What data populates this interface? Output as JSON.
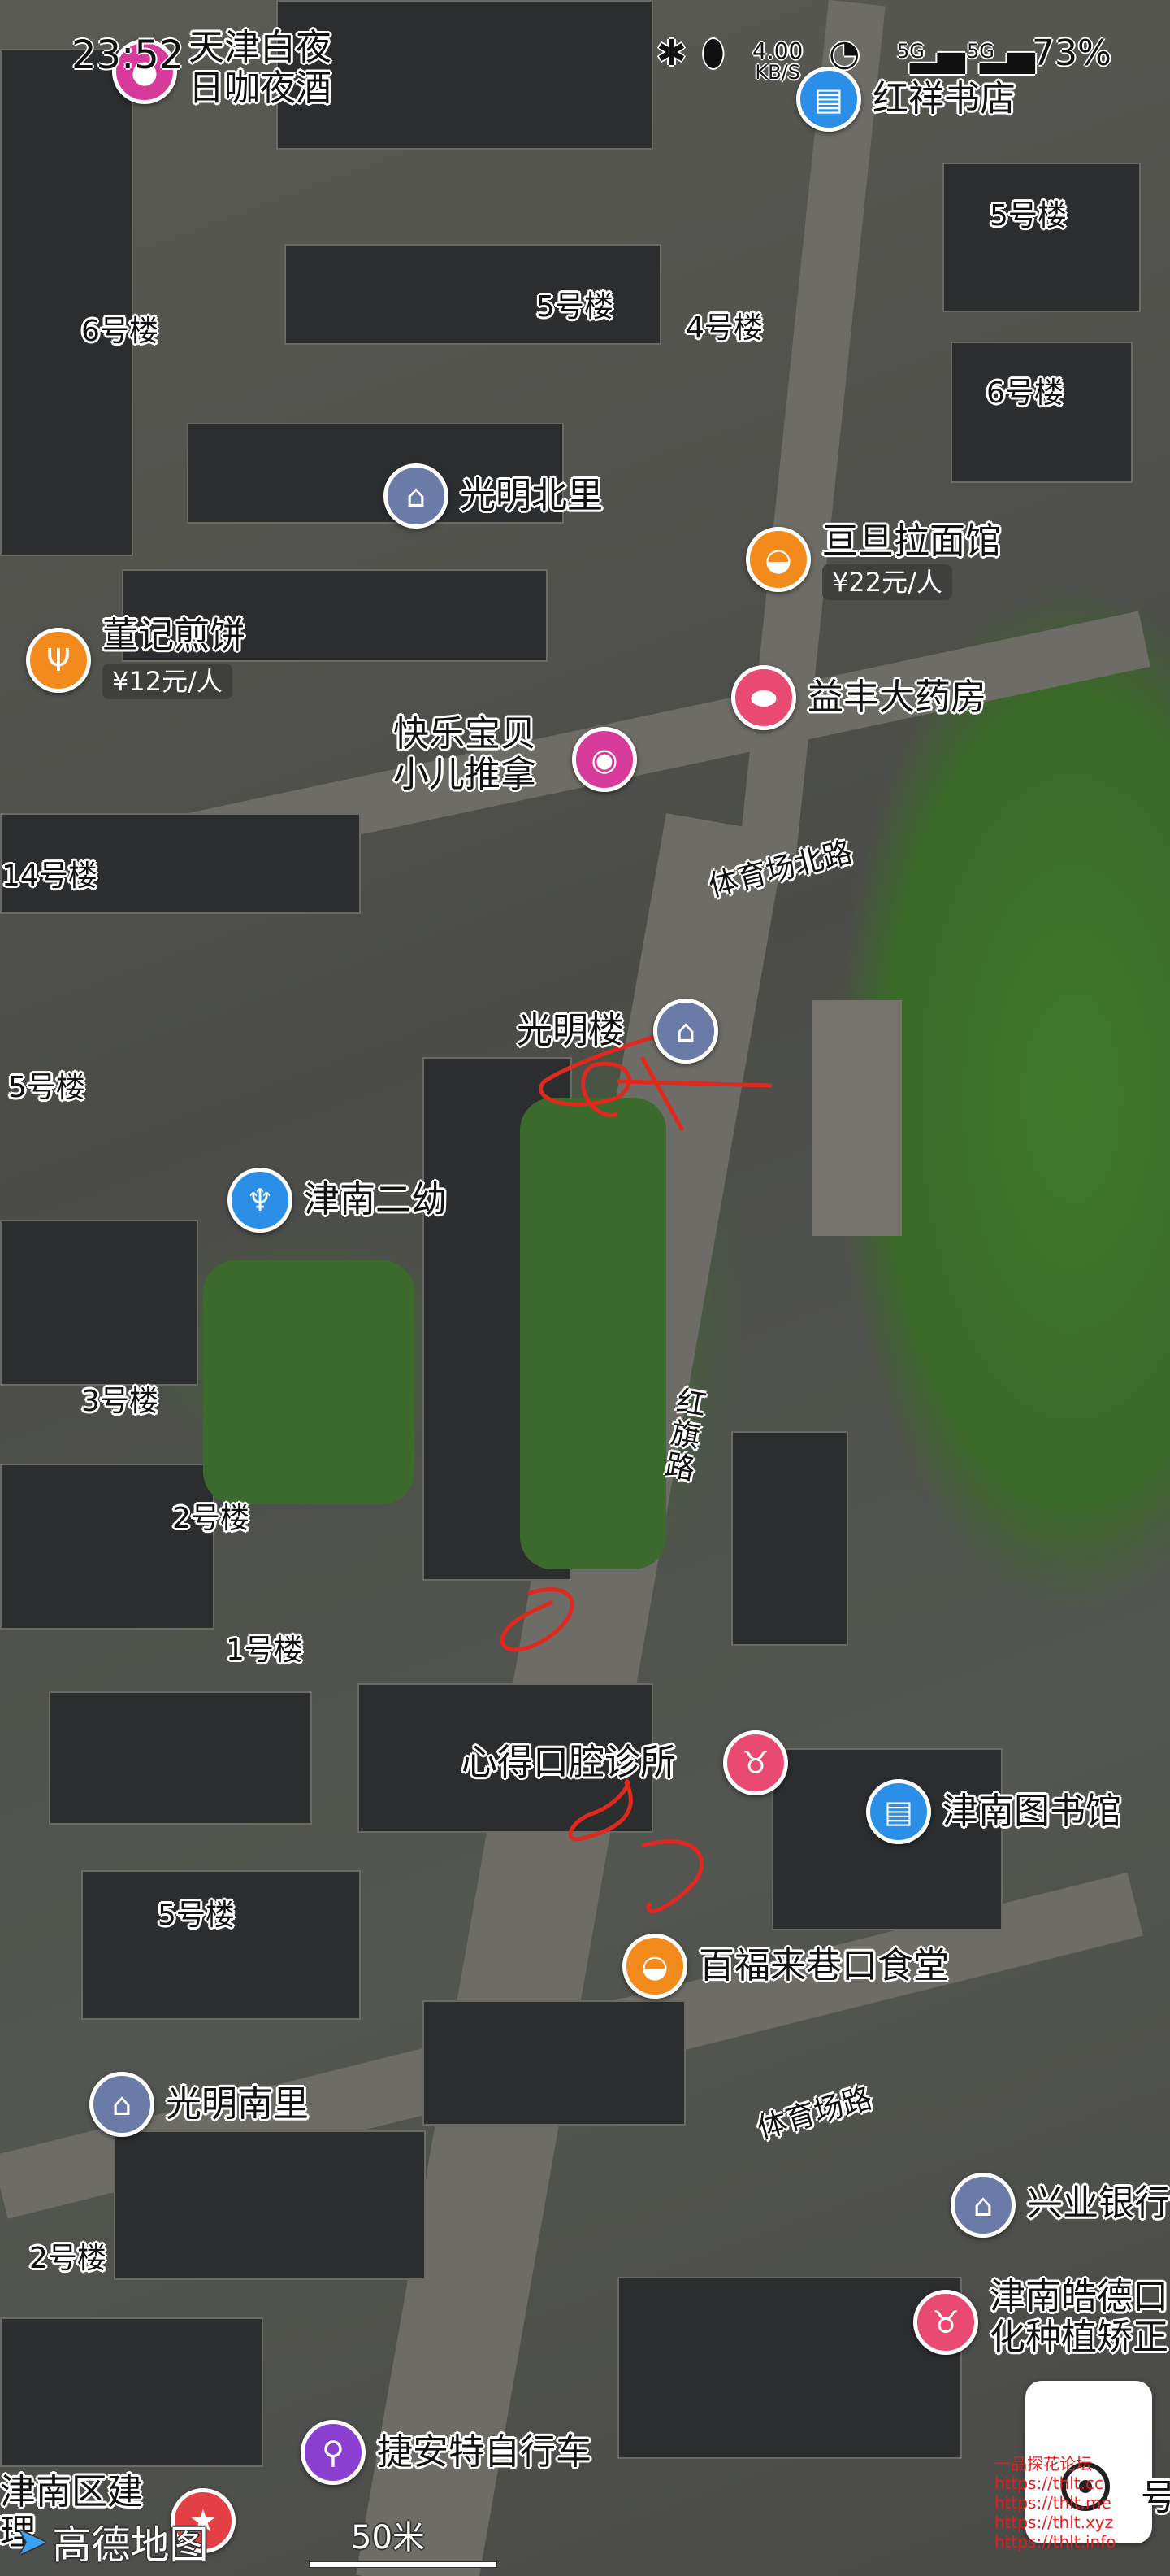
{
  "status_bar": {
    "time": "23:52",
    "speed_value": "4.00",
    "speed_unit": "KB/S",
    "net1": "5G",
    "net2": "5G",
    "battery": "73%"
  },
  "pois": [
    {
      "name": "天津白夜\n日咖夜酒",
      "icon": "pink-poi-icon",
      "color": "#d63a9a"
    },
    {
      "name": "红祥书店",
      "icon": "book-icon",
      "color": "#2b8fe8"
    },
    {
      "name": "光明北里",
      "icon": "residential-icon",
      "color": "#6a7ba8"
    },
    {
      "name": "亘旦拉面馆",
      "price": "¥22元/人",
      "icon": "noodle-icon",
      "color": "#f28a1c"
    },
    {
      "name": "董记煎饼",
      "price": "¥12元/人",
      "icon": "fork-knife-icon",
      "color": "#f28a1c"
    },
    {
      "name": "益丰大药房",
      "icon": "pill-icon",
      "color": "#e94a72"
    },
    {
      "name": "快乐宝贝\n小儿推拿",
      "icon": "dot-icon",
      "color": "#d63a9a"
    },
    {
      "name": "光明楼",
      "icon": "residential-icon",
      "color": "#6a7ba8"
    },
    {
      "name": "津南二幼",
      "icon": "kindergarten-icon",
      "color": "#2b8fe8"
    },
    {
      "name": "心得口腔诊所",
      "icon": "tooth-icon",
      "color": "#e94a72"
    },
    {
      "name": "津南图书馆",
      "icon": "book-icon",
      "color": "#2b8fe8"
    },
    {
      "name": "百福来巷口食堂",
      "icon": "noodle-icon",
      "color": "#f28a1c"
    },
    {
      "name": "光明南里",
      "icon": "residential-icon",
      "color": "#6a7ba8"
    },
    {
      "name": "兴业银行",
      "icon": "bank-icon",
      "color": "#6a7ba8"
    },
    {
      "name": "津南皓德口\n化种植矫正",
      "icon": "tooth-icon",
      "color": "#e94a72"
    },
    {
      "name": "捷安特自行车",
      "icon": "bicycle-icon",
      "color": "#8b3fd1"
    },
    {
      "name": "津南区建\n理",
      "icon": "star-icon",
      "color": "#e43f42"
    }
  ],
  "buildings": [
    "5号楼",
    "4号楼",
    "6号楼",
    "5号楼",
    "6号楼",
    "14号楼",
    "5号楼",
    "3号楼",
    "2号楼",
    "1号楼",
    "5号楼",
    "2号楼"
  ],
  "roads": [
    "体育场北路",
    "红\n旗\n路",
    "体育场路"
  ],
  "map_brand": "高德地图",
  "scale": "50米",
  "watermark": "一品探花论坛\nhttps://thlt.cc\nhttps://thlt.me\nhttps://thlt.xyz\nhttps://thlt.info",
  "partial_label": "号"
}
